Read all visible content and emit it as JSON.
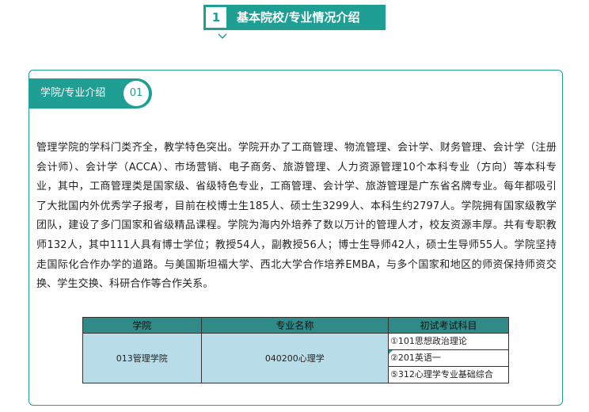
{
  "section": {
    "number": "1",
    "title": "基本院校/专业情况介绍"
  },
  "card": {
    "tab_label": "学院/专业介绍",
    "tab_number": "01",
    "paragraph": "管理学院的学科门类齐全，教学特色突出。学院开办了工商管理、物流管理、会计学、财务管理、会计学（注册会计师）、会计学（ACCA）、市场营销、电子商务、旅游管理、人力资源管理10个本科专业（方向）等本科专业，其中，工商管理类是国家级、省级特色专业，工商管理、会计学、旅游管理是广东省名牌专业。每年都吸引了大批国内外优秀学子报考，目前在校博士生185人、硕士生3299人、本科生约2797人。学院拥有国家级教学团队，建设了多门国家和省级精品课程。学院为海内外培养了数以万计的管理人才，校友资源丰厚。共有专职教师132人，其中111人具有博士学位；教授54人，副教授56人；博士生导师42人，硕士生导师55人。学院坚持走国际化合作办学的道路。与美国斯坦福大学、西北大学合作培养EMBA，与多个国家和地区的师资保持师资交换、学生交换、科研合作等合作关系。"
  },
  "table": {
    "headers": [
      "学院",
      "专业名称",
      "初试考试科目"
    ],
    "college": "013管理学院",
    "major": "040200心理学",
    "subjects": [
      "①101思想政治理论",
      "②201英语一",
      "⑤312心理学专业基础综合"
    ]
  },
  "colors": {
    "accent": "#1f9f94",
    "table_header": "#2e8b88",
    "table_body": "#b8dde8"
  },
  "icons": {
    "chevron": "chevron-down-icon"
  }
}
